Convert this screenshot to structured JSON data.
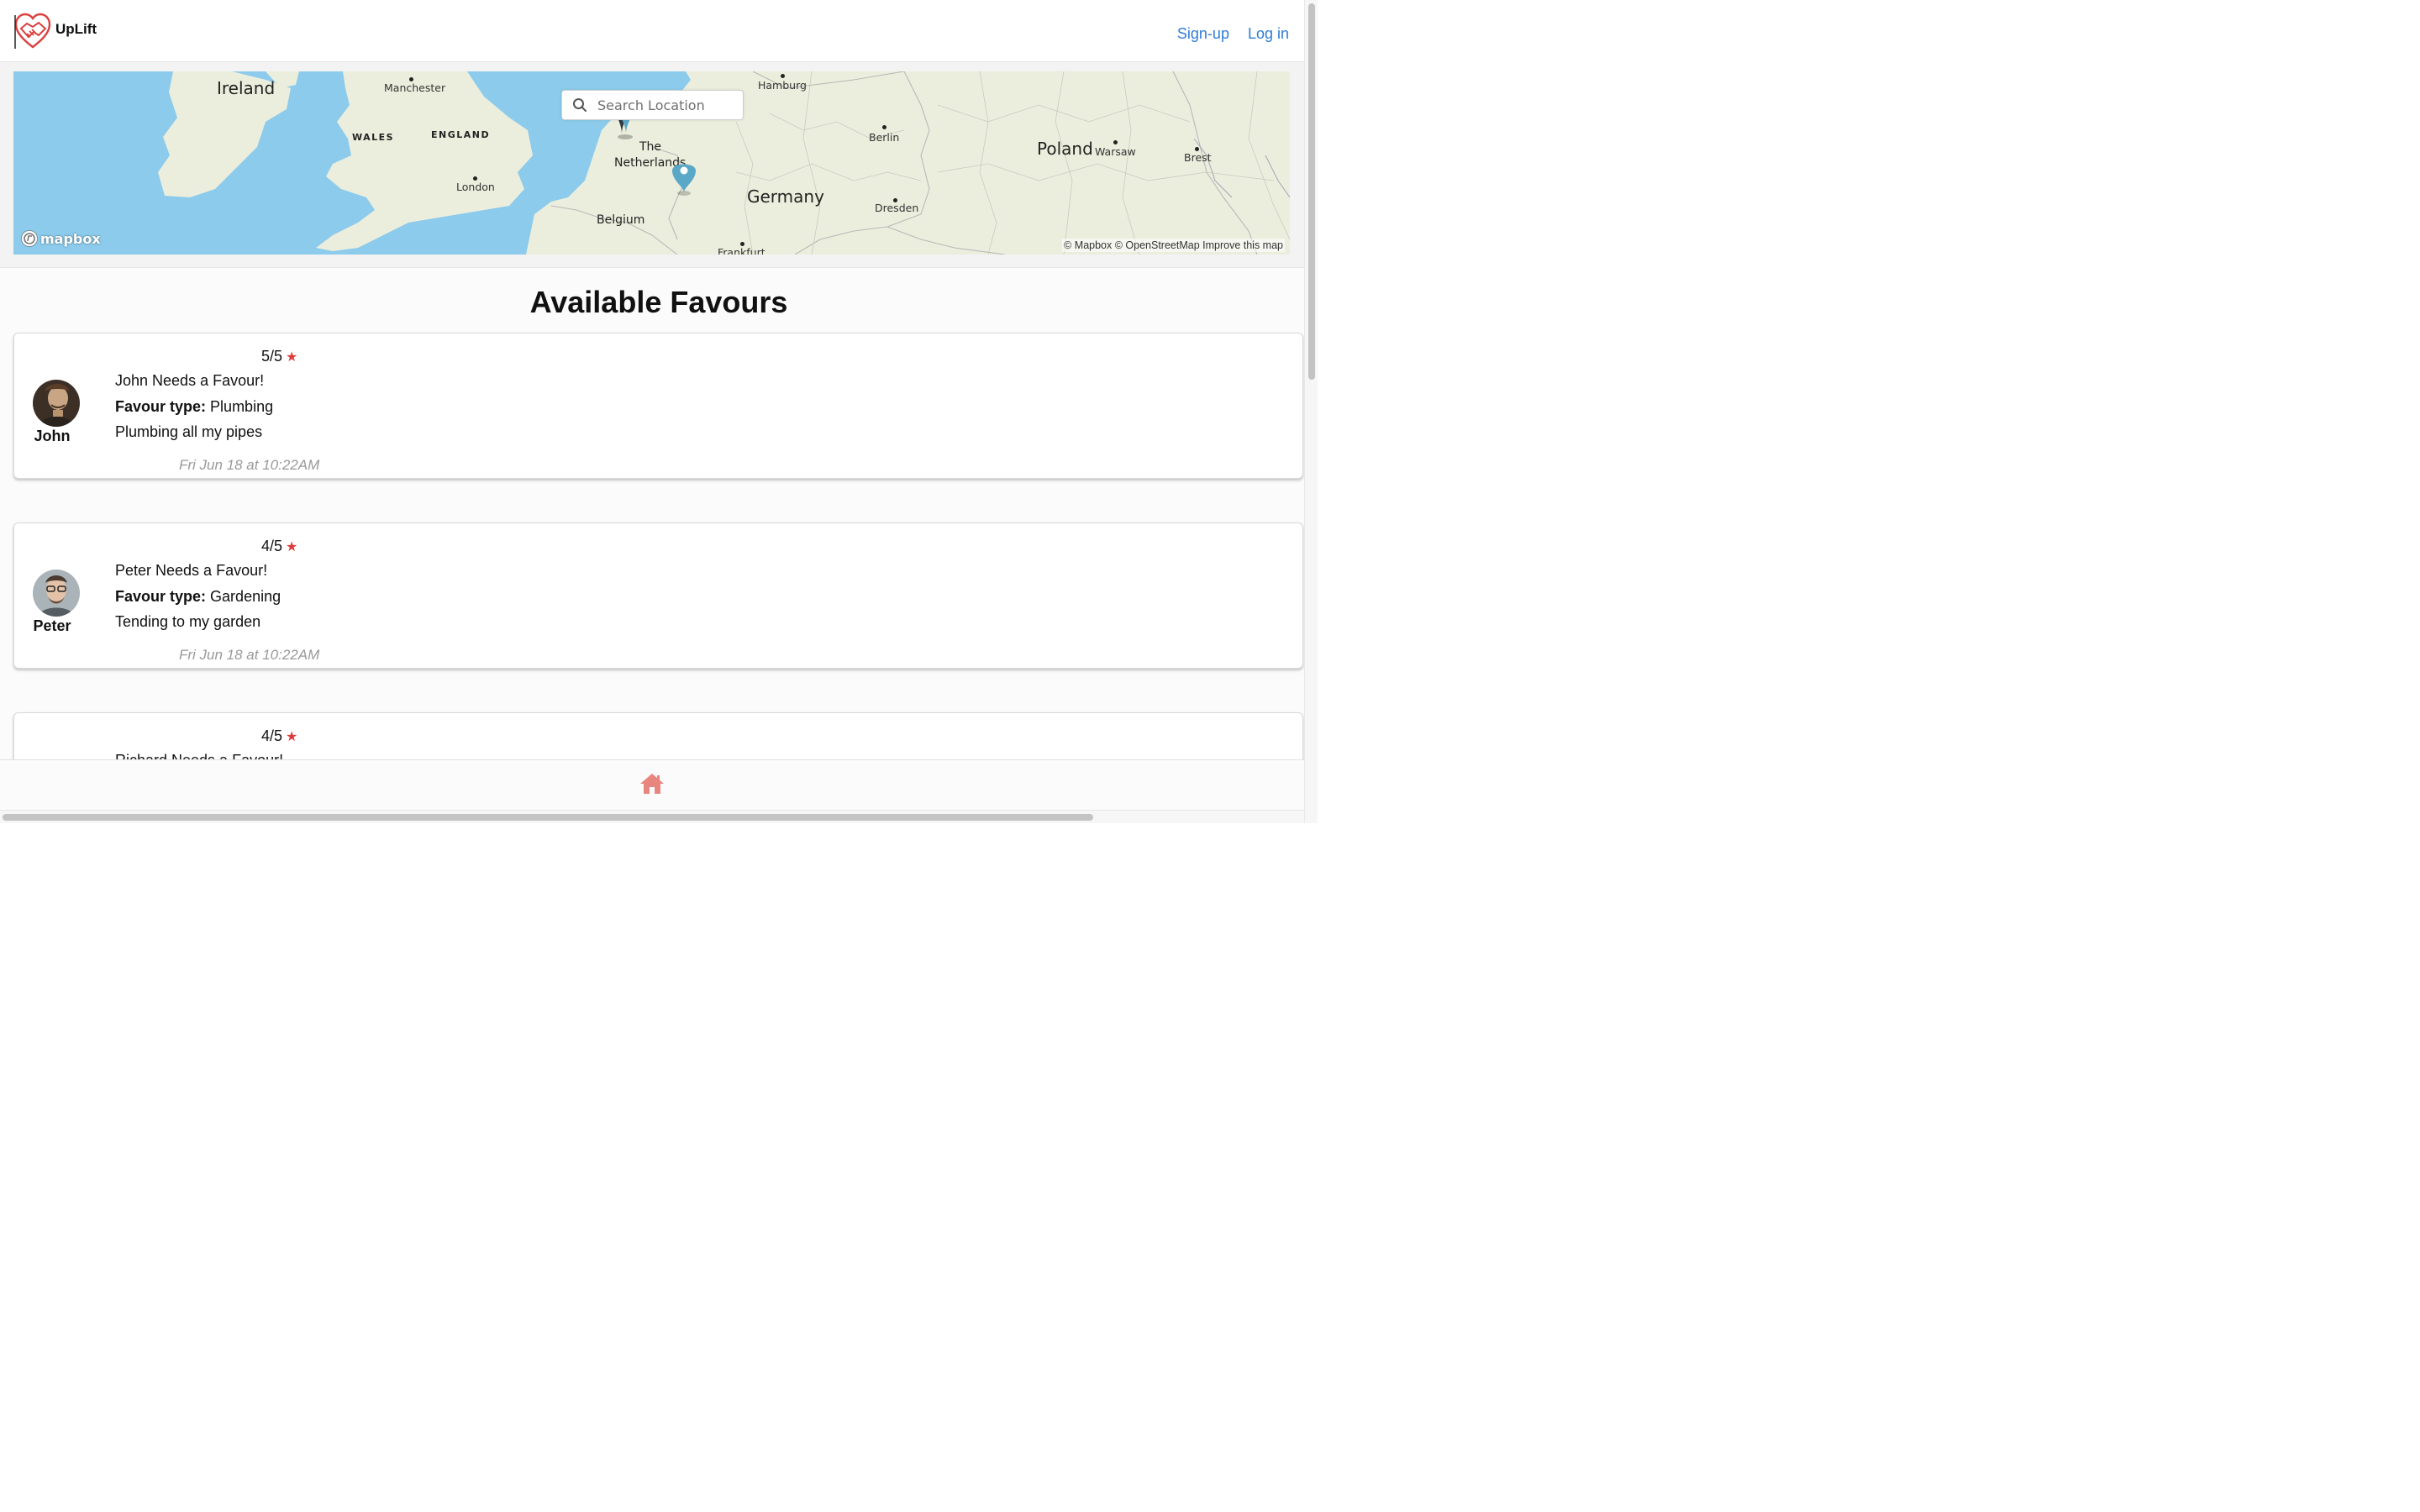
{
  "app": {
    "name": "UpLift",
    "logo_icon": "handshake-heart-icon"
  },
  "nav": {
    "signup_label": "Sign-up",
    "login_label": "Log in",
    "link_color": "#2f7dd6"
  },
  "map": {
    "search_placeholder": "Search Location",
    "provider_logo": "mapbox",
    "attribution": "© Mapbox © OpenStreetMap Improve this map",
    "labels": {
      "ireland": "Ireland",
      "manchester": "Manchester",
      "wales": "WALES",
      "england": "ENGLAND",
      "london": "London",
      "hamburg": "Hamburg",
      "the": "The",
      "netherlands": "Netherlands",
      "belgium": "Belgium",
      "germany": "Germany",
      "berlin": "Berlin",
      "dresden": "Dresden",
      "frankfurt": "Frankfurt",
      "poland": "Poland",
      "warsaw": "Warsaw",
      "brest": "Brest"
    },
    "marker_color": "#5aa8c7",
    "water_color": "#8ccbeb",
    "land_color": "#eceedd"
  },
  "page": {
    "title": "Available Favours"
  },
  "favours": [
    {
      "name": "John",
      "rating": "5/5",
      "headline": "John Needs a Favour!",
      "type_label": "Favour type:",
      "type": "Plumbing",
      "description": "Plumbing all my pipes",
      "date": "Fri Jun 18 at 10:22AM"
    },
    {
      "name": "Peter",
      "rating": "4/5",
      "headline": "Peter Needs a Favour!",
      "type_label": "Favour type:",
      "type": "Gardening",
      "description": "Tending to my garden",
      "date": "Fri Jun 18 at 10:22AM"
    },
    {
      "rating": "4/5",
      "headline": "Richard Needs a Favour!"
    }
  ],
  "rating_star": "★",
  "star_color": "#e03b3b",
  "footer": {
    "home_icon": "home-icon",
    "home_color": "#e8857e"
  }
}
